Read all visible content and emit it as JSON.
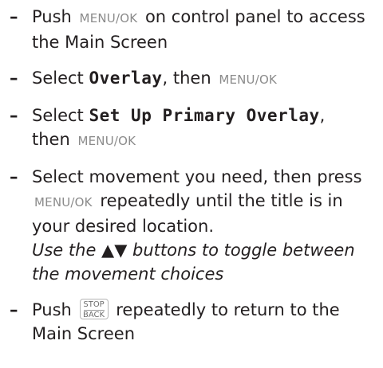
{
  "steps": [
    {
      "before": "Push",
      "button": "MENU/OK",
      "after": "on control panel to access the Main Screen"
    },
    {
      "before": "Select",
      "menu": "Overlay",
      "middle": ", then",
      "button": "MENU/OK"
    },
    {
      "before": "Select",
      "menu": "Set Up Primary Overlay",
      "middle": ",",
      "line2": "then",
      "button": "MENU/OK"
    },
    {
      "before": "Select movement you need, then press",
      "button": "MENU/OK",
      "after": "repeatedly until the title is in your desired location.",
      "note": "Use the ▲▼ buttons to toggle between the movement choices"
    },
    {
      "before": "Push",
      "key_top": "STOP",
      "key_bottom": "BACK",
      "after": "repeatedly to return to the Main Screen"
    }
  ],
  "dash": "–"
}
